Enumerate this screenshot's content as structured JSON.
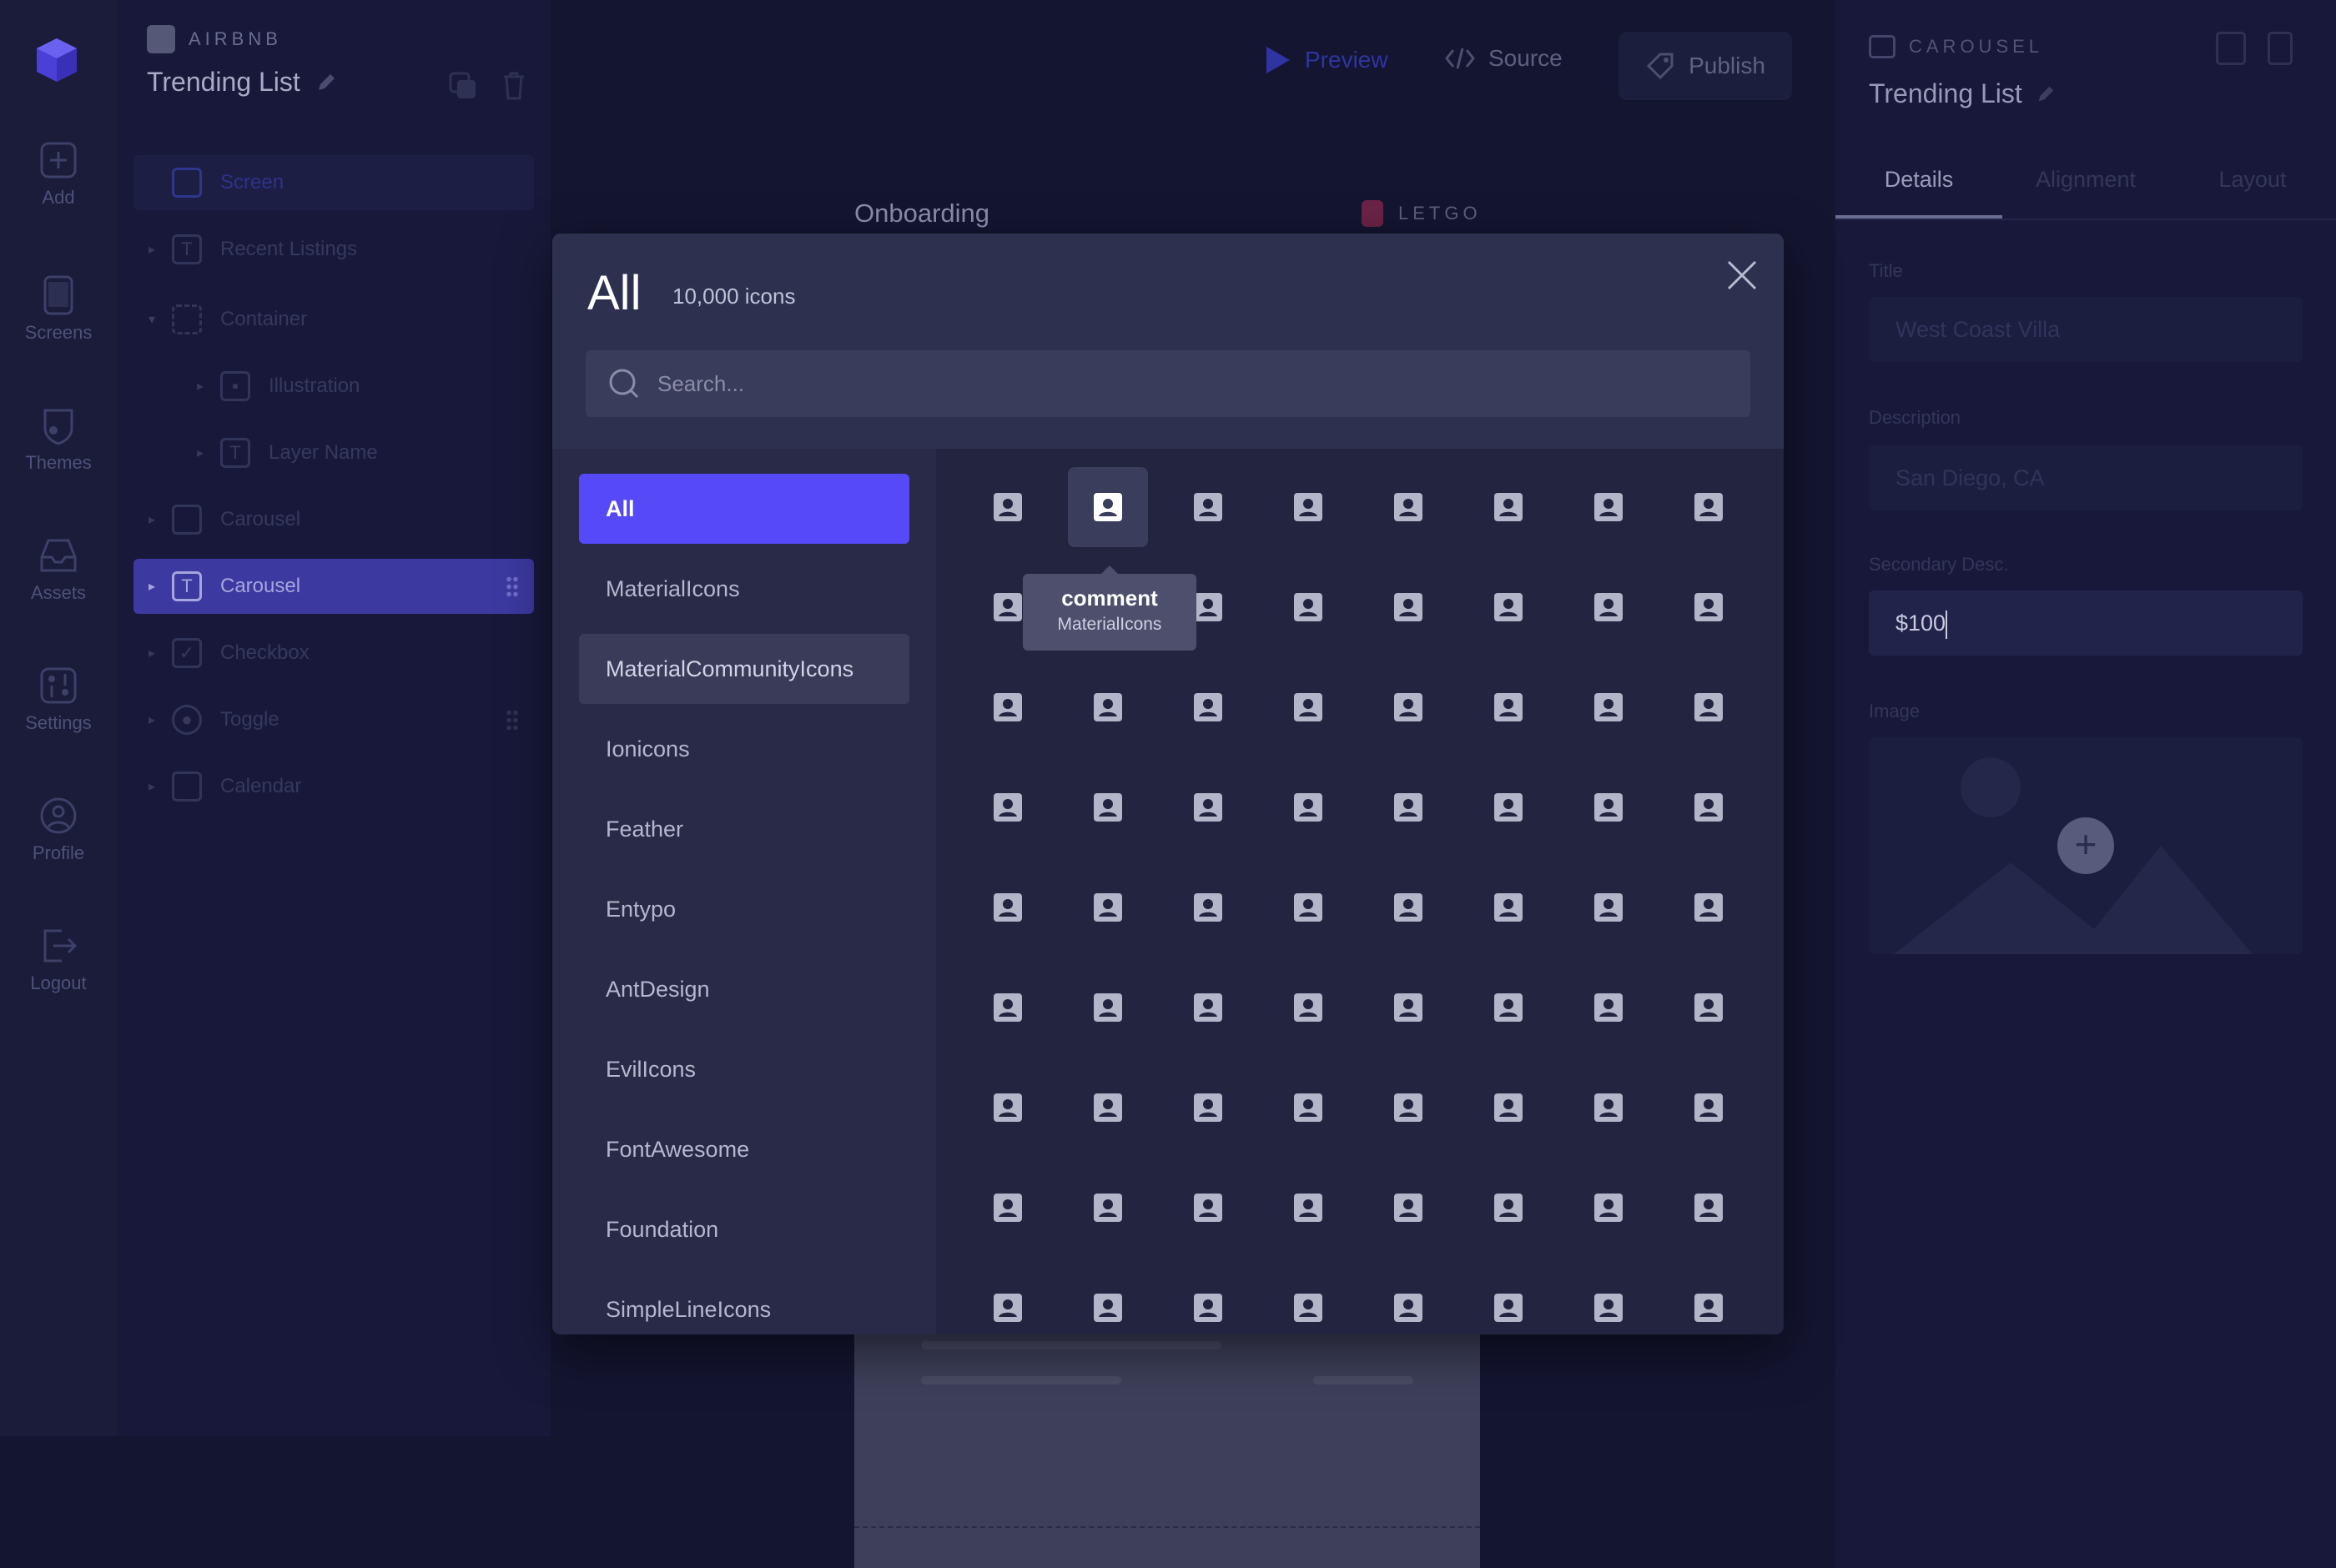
{
  "nav": {
    "items": [
      {
        "label": "Add",
        "icon": "plus-square-icon"
      },
      {
        "label": "Screens",
        "icon": "tablet-icon"
      },
      {
        "label": "Themes",
        "icon": "shield-icon"
      },
      {
        "label": "Assets",
        "icon": "inbox-icon"
      },
      {
        "label": "Settings",
        "icon": "sliders-icon"
      },
      {
        "label": "Profile",
        "icon": "user-circle-icon"
      },
      {
        "label": "Logout",
        "icon": "logout-icon"
      }
    ]
  },
  "project": {
    "tag": "AIRBNB",
    "title": "Trending List"
  },
  "layers": [
    {
      "label": "Screen",
      "icon": "tablet-icon",
      "state": "screen"
    },
    {
      "label": "Recent Listings",
      "icon": "text-icon"
    },
    {
      "label": "Container",
      "icon": "container-icon"
    },
    {
      "label": "Illustration",
      "icon": "image-icon"
    },
    {
      "label": "Layer Name",
      "icon": "text-icon"
    },
    {
      "label": "Carousel",
      "icon": "carousel-icon"
    },
    {
      "label": "Carousel",
      "icon": "text-icon",
      "state": "selected"
    },
    {
      "label": "Checkbox",
      "icon": "checkbox-icon"
    },
    {
      "label": "Toggle",
      "icon": "toggle-icon"
    },
    {
      "label": "Calendar",
      "icon": "calendar-icon"
    }
  ],
  "toolbar": {
    "preview_label": "Preview",
    "source_label": "Source",
    "publish_label": "Publish"
  },
  "canvas": {
    "left_screen_label": "Onboarding",
    "right_screen_label": "LETGO"
  },
  "properties": {
    "tag": "CAROUSEL",
    "title": "Trending List",
    "tabs": [
      "Details",
      "Alignment",
      "Layout"
    ],
    "active_tab": "Details",
    "fields": {
      "title_label": "Title",
      "title_value": "West Coast Villa",
      "description_label": "Description",
      "description_value": "San Diego, CA",
      "secondary_label": "Secondary Desc.",
      "secondary_value": "$100",
      "image_label": "Image"
    }
  },
  "modal": {
    "title": "All",
    "count": "10,000 icons",
    "search_placeholder": "Search...",
    "categories": [
      "All",
      "MaterialIcons",
      "MaterialCommunityIcons",
      "Ionicons",
      "Feather",
      "Entypo",
      "AntDesign",
      "EvilIcons",
      "FontAwesome",
      "Foundation",
      "SimpleLineIcons"
    ],
    "active_category": "All",
    "hover_category": "MaterialCommunityIcons",
    "icon_name": "contact-icon",
    "tooltip": {
      "name": "comment",
      "set": "MaterialIcons"
    }
  },
  "colors": {
    "accent": "#5649f7",
    "background": "#141530",
    "modal": "#272946"
  }
}
